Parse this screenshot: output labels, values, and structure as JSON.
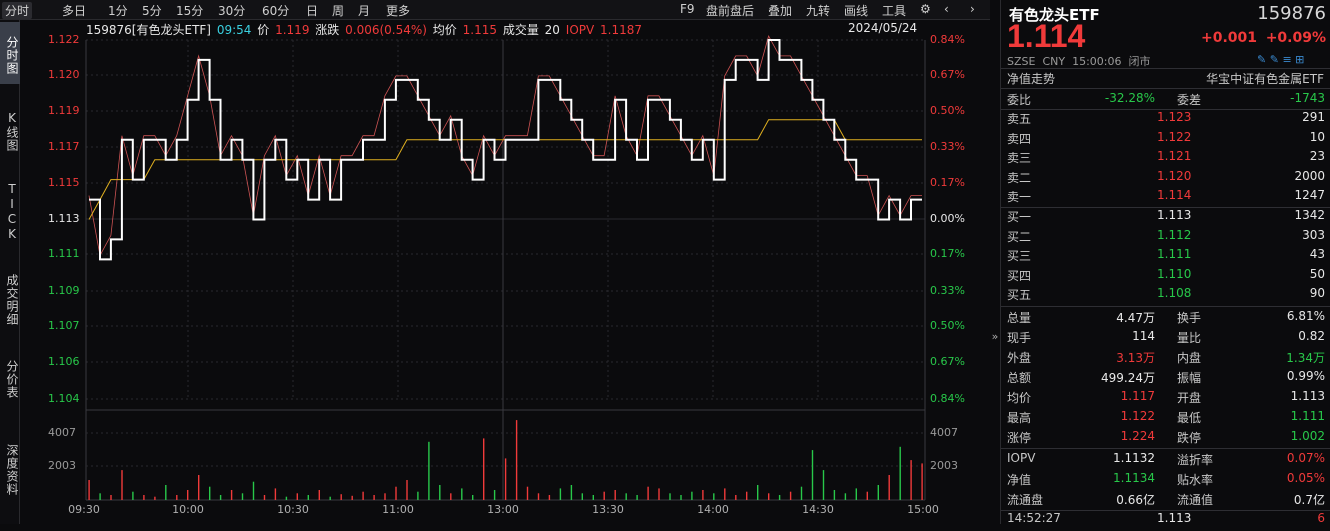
{
  "toolbar": {
    "tabs": [
      "分时",
      "多日",
      "1分",
      "5分",
      "15分",
      "30分",
      "60分",
      "日",
      "周",
      "月",
      "更多"
    ],
    "right": [
      "F9",
      "盘前盘后",
      "叠加",
      "九转",
      "画线",
      "工具"
    ]
  },
  "left_tabs": [
    "分时图",
    "K线图",
    "TICK",
    "成交明细",
    "分价表",
    "深度资料"
  ],
  "infobar": {
    "code_name": "159876[有色龙头ETF]",
    "time": "09:54",
    "price_label": "价",
    "price": "1.119",
    "change_label": "涨跌",
    "change": "0.006(0.54%)",
    "avg_label": "均价",
    "avg": "1.115",
    "vol_label": "成交量",
    "vol": "20",
    "iopv_label": "IOPV",
    "iopv": "1.1187",
    "date": "2024/05/24"
  },
  "price_axis": {
    "left": [
      "1.122",
      "1.120",
      "1.119",
      "1.117",
      "1.115",
      "1.113",
      "1.111",
      "1.109",
      "1.107",
      "1.106",
      "1.104"
    ],
    "right": [
      "0.84%",
      "0.67%",
      "0.50%",
      "0.33%",
      "0.17%",
      "0.00%",
      "0.17%",
      "0.33%",
      "0.50%",
      "0.67%",
      "0.84%"
    ],
    "prev_close": 1.113,
    "min": 1.104,
    "max": 1.122
  },
  "volume_axis": {
    "left": [
      "4007",
      "2003"
    ],
    "right": [
      "4007",
      "2003"
    ]
  },
  "time_axis": [
    "09:30",
    "10:00",
    "10:30",
    "11:00",
    "13:00",
    "13:30",
    "14:00",
    "14:30",
    "15:00"
  ],
  "chart_data": {
    "type": "line",
    "title": "",
    "series": [
      {
        "name": "价",
        "values": [
          1.114,
          1.111,
          1.112,
          1.117,
          1.115,
          1.117,
          1.117,
          1.116,
          1.117,
          1.119,
          1.121,
          1.119,
          1.116,
          1.117,
          1.116,
          1.113,
          1.116,
          1.117,
          1.115,
          1.116,
          1.114,
          1.116,
          1.114,
          1.116,
          1.116,
          1.117,
          1.117,
          1.119,
          1.12,
          1.12,
          1.119,
          1.118,
          1.117,
          1.118,
          1.116,
          1.115,
          1.117,
          1.116,
          1.117,
          1.117,
          1.117,
          1.12,
          1.12,
          1.119,
          1.118,
          1.117,
          1.116,
          1.116,
          1.119,
          1.117,
          1.116,
          1.119,
          1.119,
          1.118,
          1.117,
          1.116,
          1.117,
          1.115,
          1.12,
          1.121,
          1.121,
          1.12,
          1.122,
          1.121,
          1.121,
          1.12,
          1.119,
          1.118,
          1.117,
          1.116,
          1.115,
          1.115,
          1.113,
          1.114,
          1.113,
          1.114,
          1.114
        ]
      },
      {
        "name": "均价",
        "values": [
          1.113,
          1.114,
          1.115,
          1.115,
          1.115,
          1.115,
          1.116,
          1.116,
          1.116,
          1.116,
          1.116,
          1.116,
          1.116,
          1.116,
          1.116,
          1.116,
          1.116,
          1.116,
          1.116,
          1.116,
          1.116,
          1.116,
          1.116,
          1.116,
          1.116,
          1.116,
          1.116,
          1.116,
          1.116,
          1.117,
          1.117,
          1.117,
          1.117,
          1.117,
          1.117,
          1.117,
          1.117,
          1.117,
          1.117,
          1.117,
          1.117,
          1.117,
          1.117,
          1.117,
          1.117,
          1.117,
          1.117,
          1.117,
          1.117,
          1.117,
          1.117,
          1.117,
          1.117,
          1.117,
          1.117,
          1.117,
          1.117,
          1.117,
          1.117,
          1.117,
          1.117,
          1.117,
          1.118,
          1.118,
          1.118,
          1.118,
          1.118,
          1.118,
          1.118,
          1.117,
          1.117,
          1.117,
          1.117,
          1.117,
          1.117,
          1.117,
          1.117
        ]
      }
    ],
    "volume": [
      1200,
      400,
      300,
      1800,
      500,
      300,
      200,
      900,
      300,
      600,
      1500,
      800,
      300,
      600,
      400,
      1100,
      300,
      700,
      200,
      400,
      300,
      600,
      200,
      350,
      250,
      500,
      300,
      400,
      800,
      1200,
      500,
      3500,
      900,
      400,
      700,
      300,
      3700,
      600,
      2500,
      4800,
      800,
      400,
      300,
      700,
      900,
      400,
      300,
      500,
      600,
      400,
      300,
      800,
      700,
      400,
      300,
      500,
      600,
      400,
      700,
      300,
      500,
      900,
      400,
      300,
      500,
      800,
      3000,
      1800,
      600,
      400,
      700,
      500,
      900,
      1500,
      3200,
      2400,
      2200
    ],
    "ylim": [
      1.104,
      1.122
    ]
  },
  "quote": {
    "name": "有色龙头ETF",
    "code": "159876",
    "price": "1.114",
    "change": "+0.001",
    "change_pct": "+0.09%",
    "market": "SZSE",
    "currency": "CNY",
    "time": "15:00:06",
    "status": "闭市",
    "nav_label": "净值走势",
    "index_name": "华宝中证有色金属ETF"
  },
  "ratio": {
    "wb_label": "委比",
    "wb": "-32.28%",
    "wc_label": "委差",
    "wc": "-1743"
  },
  "asks": [
    {
      "label": "卖五",
      "price": "1.123",
      "vol": "291"
    },
    {
      "label": "卖四",
      "price": "1.122",
      "vol": "10"
    },
    {
      "label": "卖三",
      "price": "1.121",
      "vol": "23"
    },
    {
      "label": "卖二",
      "price": "1.120",
      "vol": "2000"
    },
    {
      "label": "卖一",
      "price": "1.114",
      "vol": "1247"
    }
  ],
  "bids": [
    {
      "label": "买一",
      "price": "1.113",
      "vol": "1342"
    },
    {
      "label": "买二",
      "price": "1.112",
      "vol": "303"
    },
    {
      "label": "买三",
      "price": "1.111",
      "vol": "43"
    },
    {
      "label": "买四",
      "price": "1.110",
      "vol": "50"
    },
    {
      "label": "买五",
      "price": "1.108",
      "vol": "90"
    }
  ],
  "stats": [
    {
      "l1": "总量",
      "v1": "4.47万",
      "l2": "换手",
      "v2": "6.81%"
    },
    {
      "l1": "现手",
      "v1": "114",
      "l2": "量比",
      "v2": "0.82"
    },
    {
      "l1": "外盘",
      "v1": "3.13万",
      "l2": "内盘",
      "v2": "1.34万"
    },
    {
      "l1": "总额",
      "v1": "499.24万",
      "l2": "振幅",
      "v2": "0.99%"
    },
    {
      "l1": "均价",
      "v1": "1.117",
      "l2": "开盘",
      "v2": "1.113"
    },
    {
      "l1": "最高",
      "v1": "1.122",
      "l2": "最低",
      "v2": "1.111"
    },
    {
      "l1": "涨停",
      "v1": "1.224",
      "l2": "跌停",
      "v2": "1.002"
    }
  ],
  "extra": [
    {
      "l1": "IOPV",
      "v1": "1.1132",
      "l2": "溢折率",
      "v2": "0.07%"
    },
    {
      "l1": "净值",
      "v1": "1.1134",
      "l2": "贴水率",
      "v2": "0.05%"
    },
    {
      "l1": "流通盘",
      "v1": "0.66亿",
      "l2": "流通值",
      "v2": "0.7亿"
    }
  ],
  "tick": {
    "time": "14:52:27",
    "price": "1.113",
    "vol": "6"
  },
  "colors": {
    "up": "#f03a3a",
    "down": "#28c84a",
    "price_line": "#ffffff",
    "avg_line": "#e0b020",
    "iopv_line": "#f06060"
  }
}
